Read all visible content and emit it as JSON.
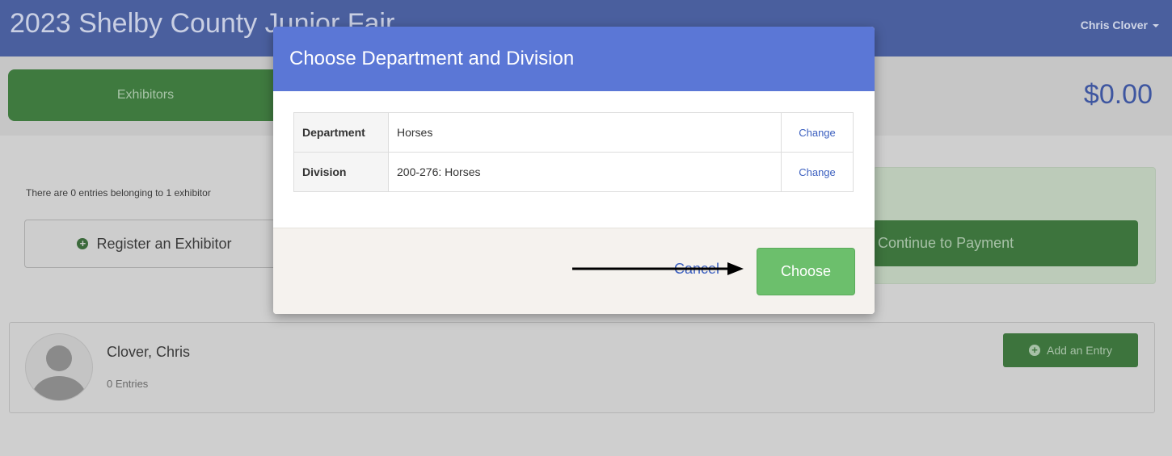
{
  "navbar": {
    "title": "2023 Shelby County Junior Fair",
    "user": "Chris Clover"
  },
  "tabs": {
    "exhibitors": "Exhibitors"
  },
  "cart": {
    "total": "$0.00"
  },
  "summary": {
    "text": "There are 0 entries belonging to 1 exhibitor",
    "register_label": "Register an Exhibitor",
    "payment_label": "Continue to Payment"
  },
  "exhibitor": {
    "name": "Clover, Chris",
    "entries": "0 Entries",
    "add_entry_label": "Add an Entry"
  },
  "modal": {
    "title": "Choose Department and Division",
    "rows": [
      {
        "label": "Department",
        "value": "Horses",
        "action": "Change"
      },
      {
        "label": "Division",
        "value": "200-276: Horses",
        "action": "Change"
      }
    ],
    "cancel_label": "Cancel",
    "choose_label": "Choose"
  },
  "colors": {
    "navbar": "#4a5f9e",
    "modal_header": "#5b77d6",
    "choose_button": "#6cbf6c",
    "link": "#3b5fbf"
  },
  "icons": {
    "plus": "plus-circle-icon",
    "caret": "caret-down-icon",
    "avatar": "user-avatar-icon",
    "annotation": "arrow-right-icon"
  }
}
